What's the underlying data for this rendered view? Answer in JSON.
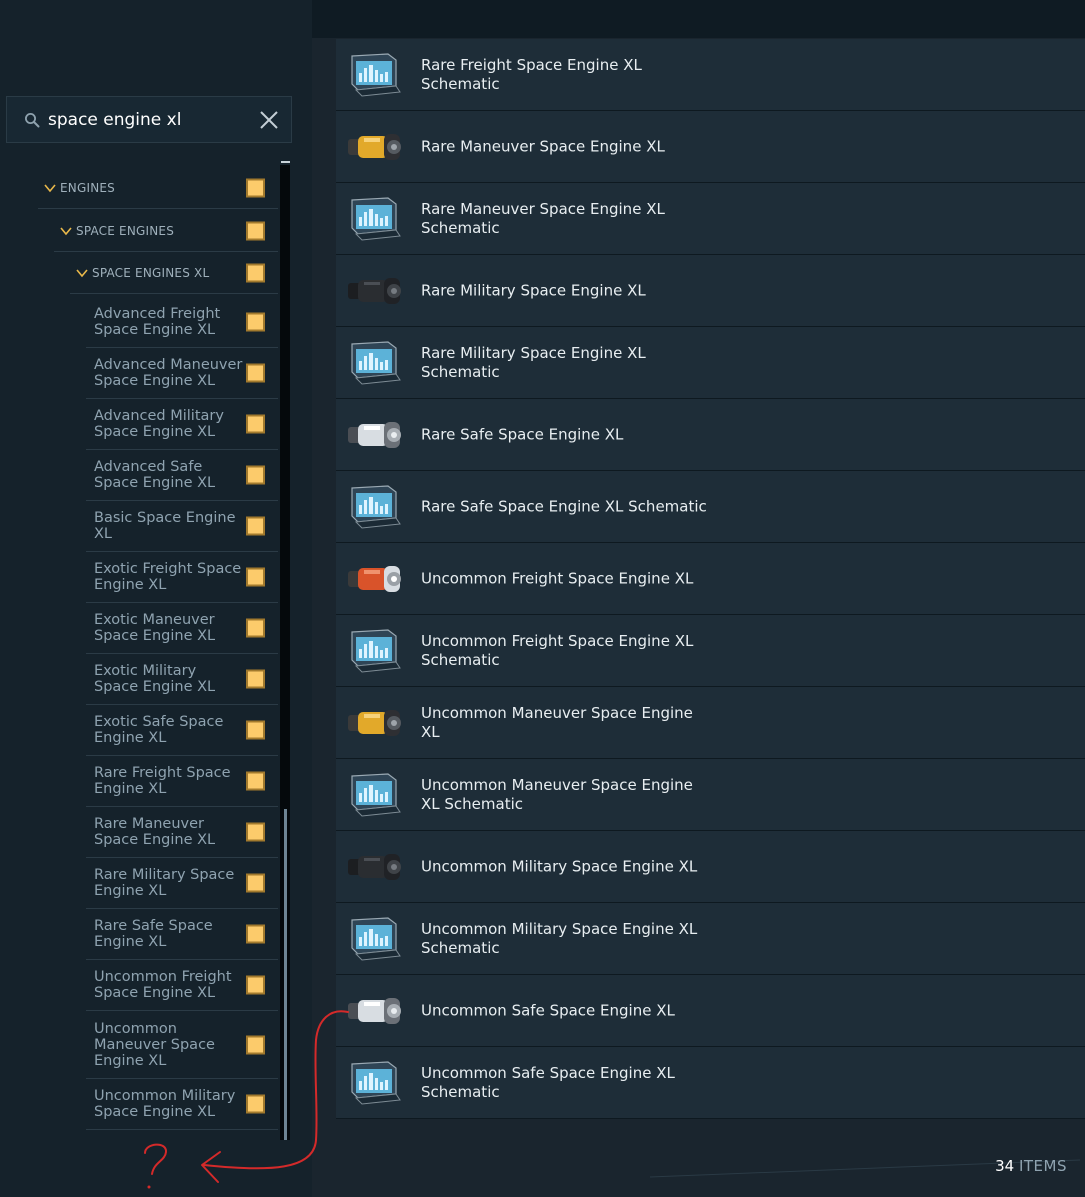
{
  "search": {
    "value": "space engine xl",
    "placeholder": "Search"
  },
  "tree": {
    "categories": [
      {
        "label": "ENGINES",
        "level": 0
      },
      {
        "label": "SPACE ENGINES",
        "level": 1
      },
      {
        "label": "SPACE ENGINES XL",
        "level": 2
      }
    ],
    "leaves": [
      "Advanced Freight Space Engine XL",
      "Advanced Maneuver Space Engine XL",
      "Advanced Military Space Engine XL",
      "Advanced Safe Space Engine XL",
      "Basic Space Engine XL",
      "Exotic Freight Space Engine XL",
      "Exotic Maneuver Space Engine XL",
      "Exotic Military Space Engine XL",
      "Exotic Safe Space Engine XL",
      "Rare Freight Space Engine XL",
      "Rare Maneuver Space Engine XL",
      "Rare Military Space Engine XL",
      "Rare Safe Space Engine XL",
      "Uncommon Freight Space Engine XL",
      "Uncommon Maneuver Space Engine XL",
      "Uncommon Military Space Engine XL"
    ]
  },
  "items": [
    {
      "name": "Rare Freight Space Engine XL Schematic",
      "icon": "schematic-icon"
    },
    {
      "name": "Rare Maneuver Space Engine XL",
      "icon": "engine-yellow-icon"
    },
    {
      "name": "Rare Maneuver Space Engine XL Schematic",
      "icon": "schematic-icon"
    },
    {
      "name": "Rare Military Space Engine XL",
      "icon": "engine-black-icon"
    },
    {
      "name": "Rare Military Space Engine XL Schematic",
      "icon": "schematic-icon"
    },
    {
      "name": "Rare Safe Space Engine XL",
      "icon": "engine-white-icon"
    },
    {
      "name": "Rare Safe Space Engine XL Schematic",
      "icon": "schematic-icon"
    },
    {
      "name": "Uncommon Freight Space Engine XL",
      "icon": "engine-orange-icon"
    },
    {
      "name": "Uncommon Freight Space Engine XL Schematic",
      "icon": "schematic-icon"
    },
    {
      "name": "Uncommon Maneuver Space Engine XL",
      "icon": "engine-yellow-icon"
    },
    {
      "name": "Uncommon Maneuver Space Engine XL Schematic",
      "icon": "schematic-icon"
    },
    {
      "name": "Uncommon Military Space Engine XL",
      "icon": "engine-black-icon"
    },
    {
      "name": "Uncommon Military Space Engine XL Schematic",
      "icon": "schematic-icon"
    },
    {
      "name": "Uncommon Safe Space Engine XL",
      "icon": "engine-white-icon"
    },
    {
      "name": "Uncommon Safe Space Engine XL Schematic",
      "icon": "schematic-icon"
    }
  ],
  "footer": {
    "count": "34",
    "unit": "ITEMS"
  },
  "colors": {
    "checkbox": "#fccb6b",
    "chevron": "#e8b84a",
    "annotation": "#d42a2a",
    "engine-yellow": "#e2a92a",
    "engine-orange": "#d9532a",
    "engine-black": "#2a2d31",
    "engine-white": "#d8dde2",
    "schematic": "#6ab4d6"
  }
}
